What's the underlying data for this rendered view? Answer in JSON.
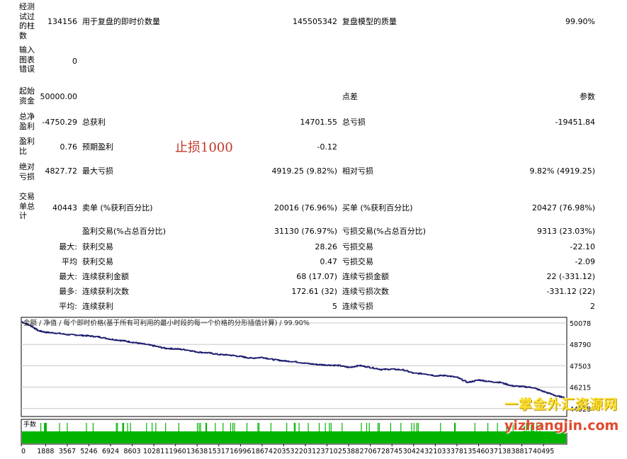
{
  "report": {
    "rows": [
      {
        "label": "经测试过的柱数",
        "value": "134156",
        "k1": "用于复盘的即时价数量",
        "v1": "145505342",
        "k2": "复盘模型的质量",
        "v2": "99.90%"
      },
      {
        "label": "输入图表错误",
        "value": "0",
        "k1": "",
        "v1": "",
        "k2": "",
        "v2": ""
      },
      {
        "label": "起始资金",
        "value": "50000.00",
        "k1": "",
        "v1": "",
        "k2": "点差",
        "v2": "参数"
      },
      {
        "label": "总净盈利",
        "value": "-4750.29",
        "k1": "总获利",
        "v1": "14701.55",
        "k2": "总亏损",
        "v2": "-19451.84"
      },
      {
        "label": "盈利比",
        "value": "0.76",
        "k1": "预期盈利",
        "v1": "-0.12",
        "k2": "",
        "v2": ""
      },
      {
        "label": "绝对亏损",
        "value": "4827.72",
        "k1": "最大亏损",
        "v1": "4919.25 (9.82%)",
        "k2": "相对亏损",
        "v2": "9.82% (4919.25)"
      },
      {
        "label": "交易单总计",
        "value": "40443",
        "k1": "卖单 (%获利百分比)",
        "v1": "20016 (76.96%)",
        "k2": "买单 (%获利百分比)",
        "v2": "20427 (76.98%)"
      }
    ],
    "extra_rows": [
      {
        "label": "",
        "k1": "盈利交易(%占总百分比)",
        "v1": "31130 (76.97%)",
        "k2": "亏损交易(%占总百分比)",
        "v2": "9313 (23.03%)"
      },
      {
        "label": "最大:",
        "k1": "获利交易",
        "v1": "28.26",
        "k2": "亏损交易",
        "v2": "-22.10"
      },
      {
        "label": "平均",
        "k1": "获利交易",
        "v1": "0.47",
        "k2": "亏损交易",
        "v2": "-2.09"
      },
      {
        "label": "最大:",
        "k1": "连续获利金额",
        "v1": "68 (17.07)",
        "k2": "连续亏损金额",
        "v2": "22 (-331.12)"
      },
      {
        "label": "最多:",
        "k1": "连续获利次数",
        "v1": "172.61 (32)",
        "k2": "连续亏损次数",
        "v2": "-331.12 (22)"
      },
      {
        "label": "平均:",
        "k1": "连续获利",
        "v1": "5",
        "k2": "连续亏损",
        "v2": "2"
      }
    ]
  },
  "annotation": "止损1000",
  "chart_data": {
    "type": "line",
    "legend_text": "金额 / 净值 / 每个即时价格(基于所有可利用的最小时段的每一个价格的分形插值计算) / 99.90%",
    "y_ticks": [
      50078,
      48790,
      47503,
      46215,
      44928
    ],
    "x_ticks": [
      0,
      1888,
      3567,
      5246,
      6924,
      8603,
      10281,
      11960,
      13638,
      15317,
      16996,
      18674,
      20353,
      22031,
      23710,
      25388,
      27067,
      28745,
      30424,
      32103,
      33781,
      35460,
      37138,
      38817,
      40495
    ],
    "xlim": [
      0,
      42300
    ],
    "ylim": [
      44450,
      50420
    ],
    "series": [
      {
        "x": [
          0,
          800,
          1300,
          1888,
          2700,
          3567,
          4400,
          5246,
          6100,
          6924,
          7800,
          8603,
          9400,
          10281,
          11100,
          11960,
          12800,
          13638,
          14500,
          15317,
          16100,
          16996,
          17800,
          18674,
          19500,
          20353,
          21200,
          22031,
          22900,
          23710,
          24600,
          25388,
          26200,
          27067,
          27900,
          28745,
          29600,
          30424,
          31300,
          32103,
          32900,
          33781,
          34600,
          35460,
          36300,
          37138,
          38000,
          38817,
          39600,
          40495,
          41500,
          42100
        ],
        "y": [
          50150,
          49880,
          49620,
          49520,
          49470,
          49380,
          49350,
          49300,
          49230,
          49100,
          49020,
          48920,
          48820,
          48700,
          48560,
          48520,
          48460,
          48330,
          48280,
          48180,
          48150,
          48060,
          47960,
          48010,
          47880,
          47800,
          47750,
          47650,
          47580,
          47550,
          47520,
          47400,
          47520,
          47400,
          47280,
          47300,
          47250,
          47050,
          47020,
          46900,
          46920,
          46800,
          46500,
          46650,
          46550,
          46500,
          46300,
          46250,
          46200,
          45950,
          45680,
          45600
        ]
      }
    ]
  },
  "volume": {
    "label": "手数"
  },
  "watermark": {
    "line1": "一掌金外汇资源网",
    "line2": "yizhangjin.com"
  },
  "colors": {
    "equity_line": "#1a1a6e",
    "volume_fill": "#00b400",
    "annotation": "#c0392b",
    "grid": "#c8c8c8"
  }
}
